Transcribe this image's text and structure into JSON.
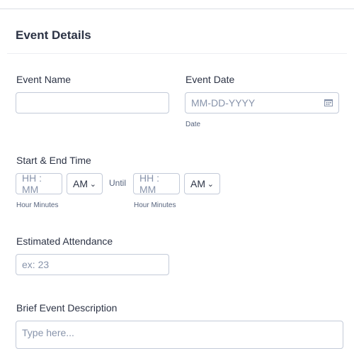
{
  "section": {
    "title": "Event Details"
  },
  "event_name": {
    "label": "Event Name",
    "value": "",
    "placeholder": ""
  },
  "event_date": {
    "label": "Event Date",
    "placeholder": "MM-DD-YYYY",
    "sublabel": "Date"
  },
  "time": {
    "label": "Start & End Time",
    "start_placeholder": "HH : MM",
    "start_ampm": "AM",
    "until": "Until",
    "end_placeholder": "HH : MM",
    "end_ampm": "AM",
    "start_sublabel": "Hour Minutes",
    "end_sublabel": "Hour Minutes"
  },
  "attendance": {
    "label": "Estimated Attendance",
    "placeholder": "ex: 23"
  },
  "description": {
    "label": "Brief Event Description",
    "placeholder": "Type here..."
  },
  "icons": {
    "date": "calendar-icon",
    "select": "chevron-down-icon"
  },
  "colors": {
    "border": "#c3cad8",
    "text": "#2c3345",
    "placeholder": "#8894ab"
  }
}
